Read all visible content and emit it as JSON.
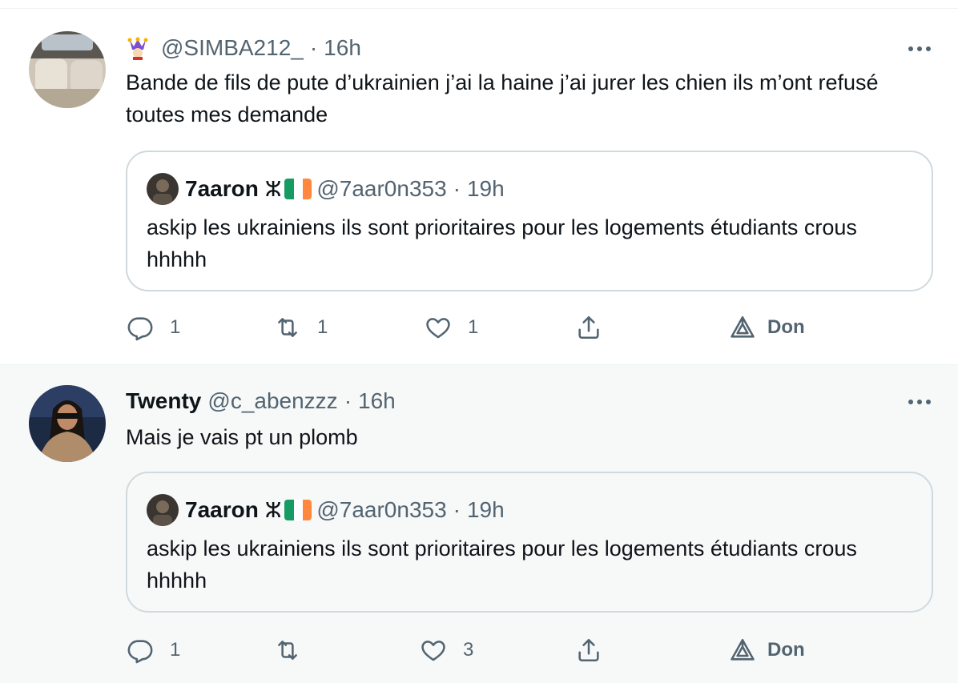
{
  "tweets": [
    {
      "handle": "@SIMBA212_",
      "dot": "·",
      "time": "16h",
      "text": "Bande de fils de pute d’ukrainien j’ai la haine j’ai jurer les chien ils m’ont refusé toutes mes demande",
      "quote": {
        "name": "7aaron",
        "flags": "ⵣ",
        "handle": "@7aar0n353",
        "dot": "·",
        "time": "19h",
        "text": "askip les ukrainiens ils sont prioritaires pour les logements étudiants crous hhhhh"
      },
      "replies": "1",
      "retweets": "1",
      "likes": "1",
      "promote": "Don"
    },
    {
      "name": "Twenty",
      "handle": "@c_abenzzz",
      "dot": "·",
      "time": "16h",
      "text": "Mais je vais pt un plomb",
      "quote": {
        "name": "7aaron",
        "flags": "ⵣ",
        "handle": "@7aar0n353",
        "dot": "·",
        "time": "19h",
        "text": "askip les ukrainiens ils sont prioritaires pour les logements étudiants crous hhhhh"
      },
      "replies": "1",
      "retweets": "",
      "likes": "3",
      "promote": "Don"
    }
  ],
  "colors": {
    "muted": "#536471",
    "text": "#0f1419",
    "border": "#cfd9de",
    "hover_bg": "#f7f9f9",
    "flag_ie": [
      "#169b62",
      "#ffffff",
      "#ff883e"
    ]
  },
  "icons": [
    "jester-emoji-icon",
    "more-icon",
    "reply-icon",
    "retweet-icon",
    "like-icon",
    "share-icon",
    "promote-icon",
    "berber-flag-icon",
    "ireland-flag-icon"
  ]
}
